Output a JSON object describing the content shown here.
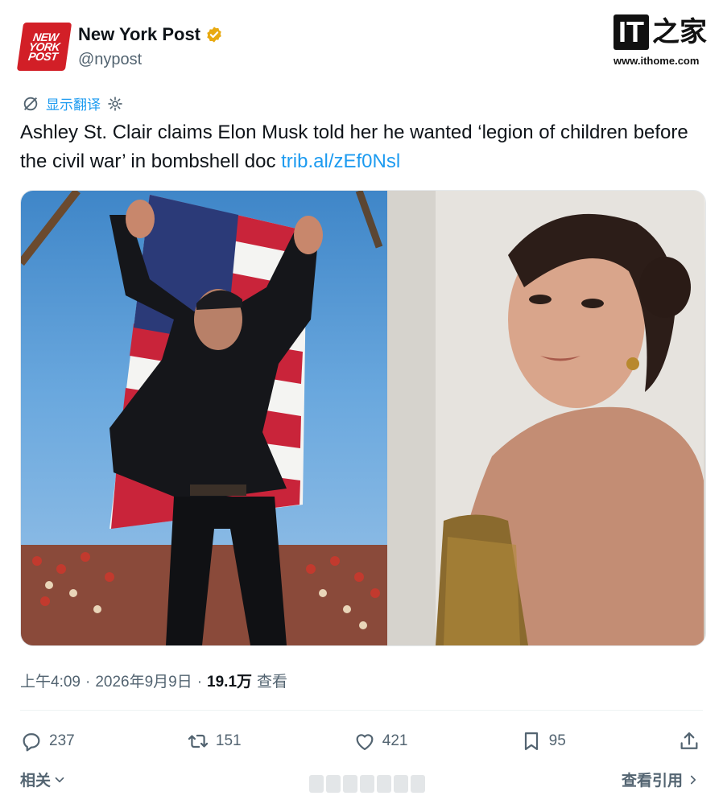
{
  "account": {
    "avatar_text": [
      "NEW",
      "YORK",
      "POST"
    ],
    "name": "New York Post",
    "handle": "@nypost",
    "verified_color": "#e8a90f",
    "avatar_color": "#d21f27"
  },
  "watermark": {
    "logo_text": "IT",
    "logo_glyph": "之家",
    "url": "www.ithome.com"
  },
  "translate": {
    "label": "显示翻译",
    "icon_left": "no-translate-icon",
    "icon_right": "gear-icon"
  },
  "tweet": {
    "text": "Ashley St. Clair claims Elon Musk told her he wanted ‘legion of children before the civil war’ in bombshell doc ",
    "link": "trib.al/zEf0Nsl"
  },
  "media": {
    "left_photo": "man-on-stage-with-american-flag",
    "right_photo": "woman-looking-over-shoulder"
  },
  "meta": {
    "time": "上午4:09",
    "sep1": "·",
    "date": "2026年9月9日",
    "sep2": "·",
    "views_count": "19.1万",
    "views_label": "查看"
  },
  "actions": {
    "reply_count": "237",
    "retweet_count": "151",
    "like_count": "421",
    "bookmark_count": "95"
  },
  "footer": {
    "related_label": "相关",
    "quotes_label": "查看引用"
  },
  "colors": {
    "accent": "#1d9bf0",
    "muted": "#536471",
    "text": "#0f1419"
  }
}
